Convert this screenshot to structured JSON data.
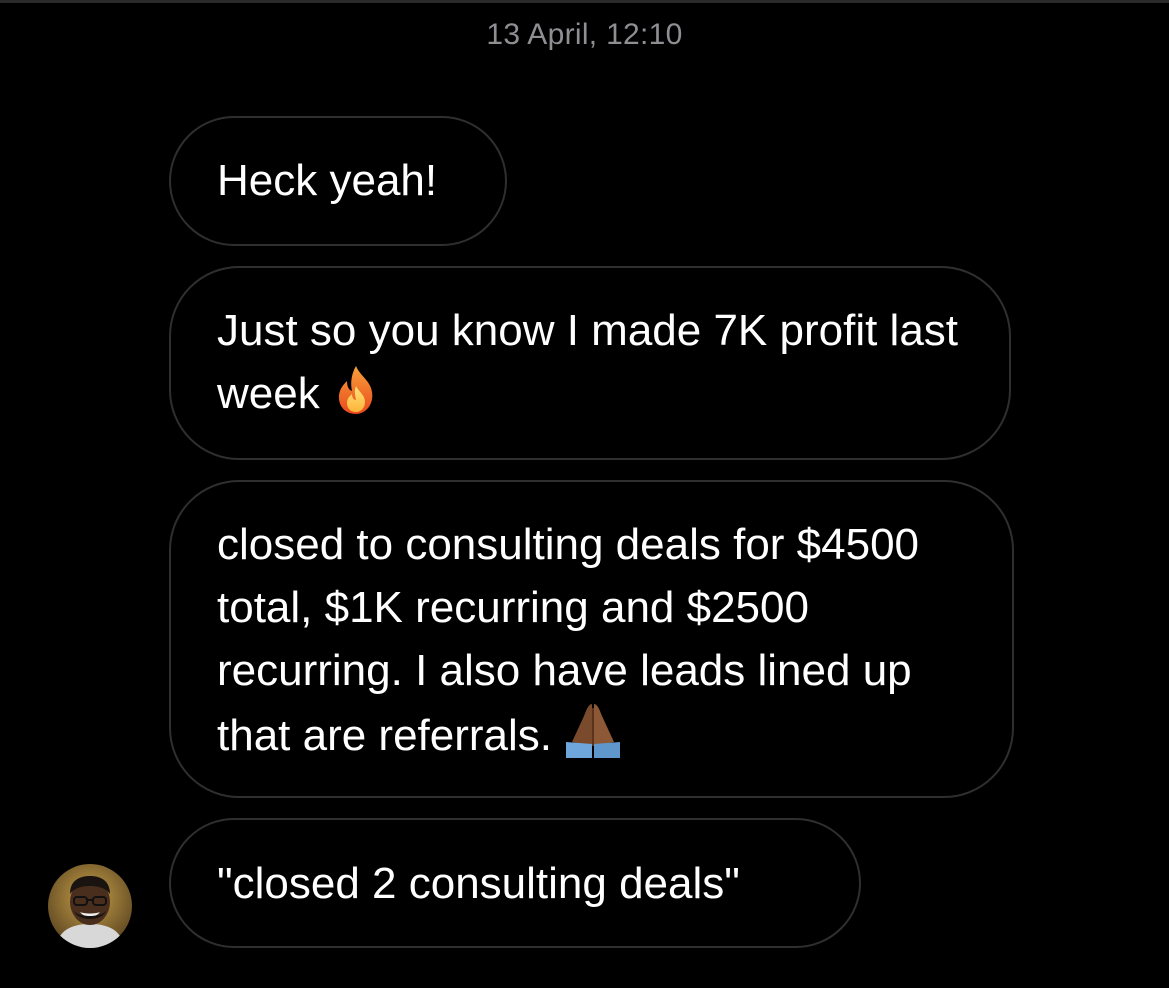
{
  "thread": {
    "timestamp": "13 April, 12:10"
  },
  "messages": [
    {
      "text": "Heck yeah!"
    },
    {
      "text": "Just so you know I made 7K profit last week",
      "emoji": "fire-icon"
    },
    {
      "text": "closed to consulting deals for $4500 total, $1K recurring and $2500 recurring. I also have leads lined up that are referrals.",
      "emoji": "folded-hands-icon"
    },
    {
      "text": "\"closed 2 consulting deals\""
    }
  ],
  "sender": {
    "avatar_icon": "person-avatar"
  },
  "colors": {
    "background": "#000000",
    "bubble_border": "#2f2f2f",
    "timestamp": "#8e8e93",
    "text": "#ffffff"
  }
}
